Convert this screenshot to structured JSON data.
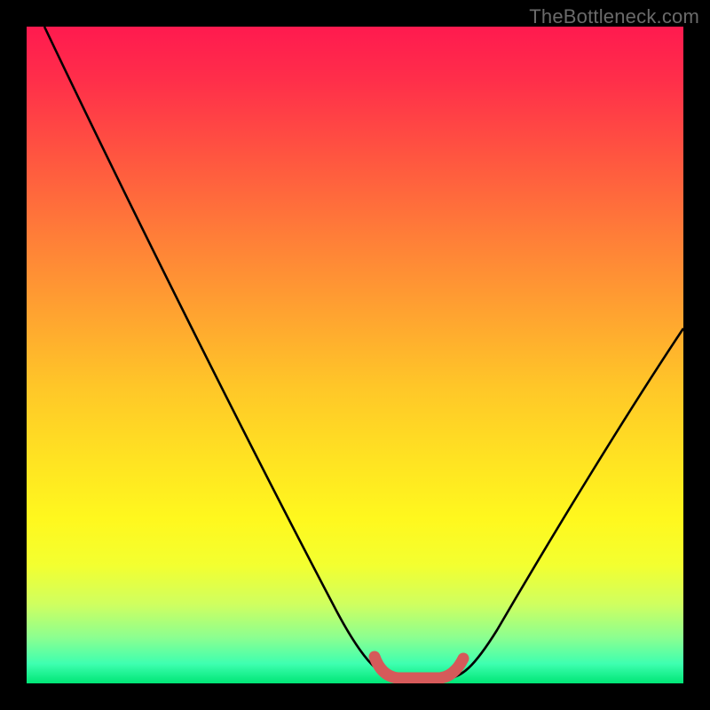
{
  "watermark": "TheBottleneck.com",
  "chart_data": {
    "type": "line",
    "title": "",
    "xlabel": "",
    "ylabel": "",
    "xlim": [
      0,
      100
    ],
    "ylim": [
      0,
      100
    ],
    "series": [
      {
        "name": "bottleneck-curve",
        "x": [
          0,
          10,
          20,
          30,
          40,
          48,
          52,
          55,
          58,
          62,
          66,
          70,
          80,
          90,
          100
        ],
        "y": [
          100,
          83,
          66,
          49,
          32,
          16,
          6,
          1,
          0,
          0,
          2,
          6,
          18,
          32,
          48
        ]
      }
    ],
    "annotations": [
      {
        "name": "optimal-zone",
        "x_start": 52,
        "x_end": 65,
        "y": 1
      }
    ],
    "background_gradient": {
      "direction": "top-to-bottom",
      "stops": [
        {
          "pos": 0,
          "color": "#ff1a4f"
        },
        {
          "pos": 50,
          "color": "#ffc728"
        },
        {
          "pos": 80,
          "color": "#fff81e"
        },
        {
          "pos": 100,
          "color": "#00e676"
        }
      ]
    }
  }
}
